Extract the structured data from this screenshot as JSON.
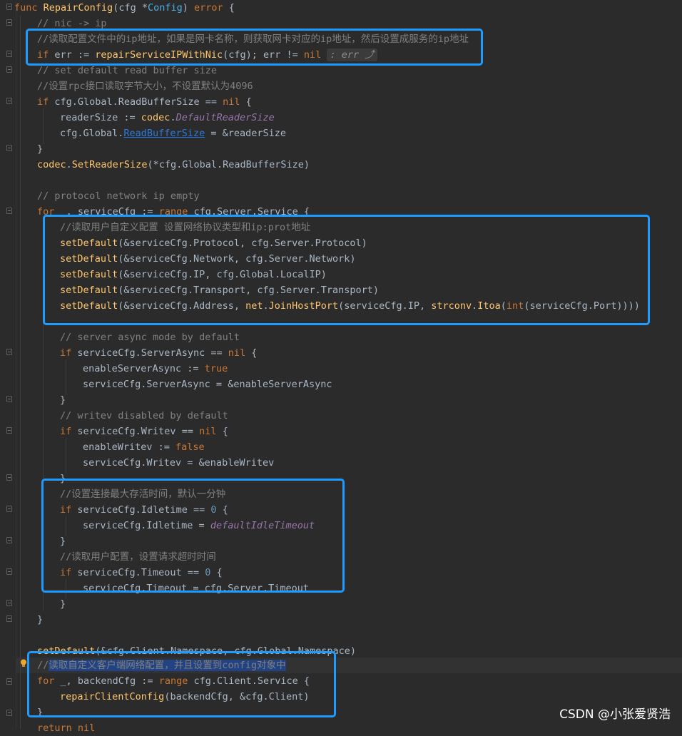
{
  "code": {
    "l1": {
      "kw": "func",
      "name": "RepairConfig",
      "p1": "(cfg *",
      "type": "Config",
      "p2": ") ",
      "kw2": "error",
      "p3": " {"
    },
    "l2": {
      "comment": "// nic -> ip"
    },
    "l3": {
      "comment": "//读取配置文件中的ip地址，如果是网卡名称，则获取网卡对应的ip地址，然后设置成服务的ip地址"
    },
    "l4": {
      "kw": "if",
      "p1": " err := ",
      "fn": "repairServiceIPWithNic",
      "p2": "(cfg); err != ",
      "kw2": "nil",
      "hint": ": err ⤴"
    },
    "l5": {
      "comment": "// set default read buffer size"
    },
    "l6": {
      "comment": "//设置rpc接口读取字节大小，不设置默认为4096"
    },
    "l7": {
      "kw": "if",
      "p1": " cfg.Global.ReadBufferSize == ",
      "kw2": "nil",
      "p2": " {"
    },
    "l8": {
      "p1": "readerSize := ",
      "pkg": "codec",
      "dot": ".",
      "it": "DefaultReaderSize"
    },
    "l9": {
      "p1": "cfg.Global.",
      "link": "ReadBufferSize",
      "p2": " = &readerSize"
    },
    "l10": {
      "p1": "}"
    },
    "l11": {
      "pkg": "codec",
      "dot": ".",
      "fn": "SetReaderSize",
      "p1": "(*cfg.Global.ReadBufferSize)"
    },
    "l13": {
      "comment": "// protocol network ip empty"
    },
    "l14": {
      "kw": "for",
      "p1": " _, serviceCfg := ",
      "kw2": "range",
      "p2": " cfg.Server.Service {"
    },
    "l15": {
      "comment": "//读取用户自定义配置 设置网络协议类型和ip:prot地址"
    },
    "l16": {
      "fn": "setDefault",
      "p1": "(&serviceCfg.Protocol, cfg.Server.Protocol)"
    },
    "l17": {
      "fn": "setDefault",
      "p1": "(&serviceCfg.Network, cfg.Server.Network)"
    },
    "l18": {
      "fn": "setDefault",
      "p1": "(&serviceCfg.IP, cfg.Global.LocalIP)"
    },
    "l19": {
      "fn": "setDefault",
      "p1": "(&serviceCfg.Transport, cfg.Server.Transport)"
    },
    "l20": {
      "fn": "setDefault",
      "p1": "(&serviceCfg.Address, ",
      "pkg": "net",
      "fn2": "JoinHostPort",
      "p2": "(serviceCfg.IP, ",
      "pkg2": "strconv",
      "fn3": "Itoa",
      "p3": "(",
      "kw": "int",
      "p4": "(serviceCfg.Port))))"
    },
    "l22": {
      "comment": "// server async mode by default"
    },
    "l23": {
      "kw": "if",
      "p1": " serviceCfg.ServerAsync == ",
      "kw2": "nil",
      "p2": " {"
    },
    "l24": {
      "p1": "enableServerAsync := ",
      "bool": "true"
    },
    "l25": {
      "p1": "serviceCfg.ServerAsync = &enableServerAsync"
    },
    "l26": {
      "p1": "}"
    },
    "l27": {
      "comment": "// writev disabled by default"
    },
    "l28": {
      "kw": "if",
      "p1": " serviceCfg.Writev == ",
      "kw2": "nil",
      "p2": " {"
    },
    "l29": {
      "p1": "enableWritev := ",
      "bool": "false"
    },
    "l30": {
      "p1": "serviceCfg.Writev = &enableWritev"
    },
    "l31": {
      "p1": "}"
    },
    "l32": {
      "comment": "//设置连接最大存活时间，默认一分钟"
    },
    "l33": {
      "kw": "if",
      "p1": " serviceCfg.Idletime == ",
      "num": "0",
      "p2": " {"
    },
    "l34": {
      "p1": "serviceCfg.Idletime = ",
      "it": "defaultIdleTimeout"
    },
    "l35": {
      "p1": "}"
    },
    "l36": {
      "comment": "//读取用户配置，设置请求超时时间"
    },
    "l37": {
      "kw": "if",
      "p1": " serviceCfg.Timeout == ",
      "num": "0",
      "p2": " {"
    },
    "l38": {
      "p1": "serviceCfg.Timeout = cfg.Server.Timeout"
    },
    "l39": {
      "p1": "}"
    },
    "l40": {
      "p1": "}"
    },
    "l42": {
      "fn": "setDefault",
      "p1": "(&cfg.Client.Namespace, cfg.Global.Namespace)"
    },
    "l43": {
      "c1": "//",
      "c2": "读取自定义客户端网络配置，并且设置到config对象中"
    },
    "l44": {
      "kw": "for",
      "p1": " _, backendCfg := ",
      "kw2": "range",
      "p2": " cfg.Client.Service {"
    },
    "l45": {
      "fn": "repairClientConfig",
      "p1": "(backendCfg, &cfg.Client)"
    },
    "l46": {
      "p1": "}"
    },
    "l47": {
      "kw": "return",
      "p1": " ",
      "kw2": "nil"
    }
  },
  "watermark": "CSDN @小张爱贤浩",
  "colors": {
    "highlight_box": "#1e9bff",
    "background": "#2b2b2b"
  }
}
